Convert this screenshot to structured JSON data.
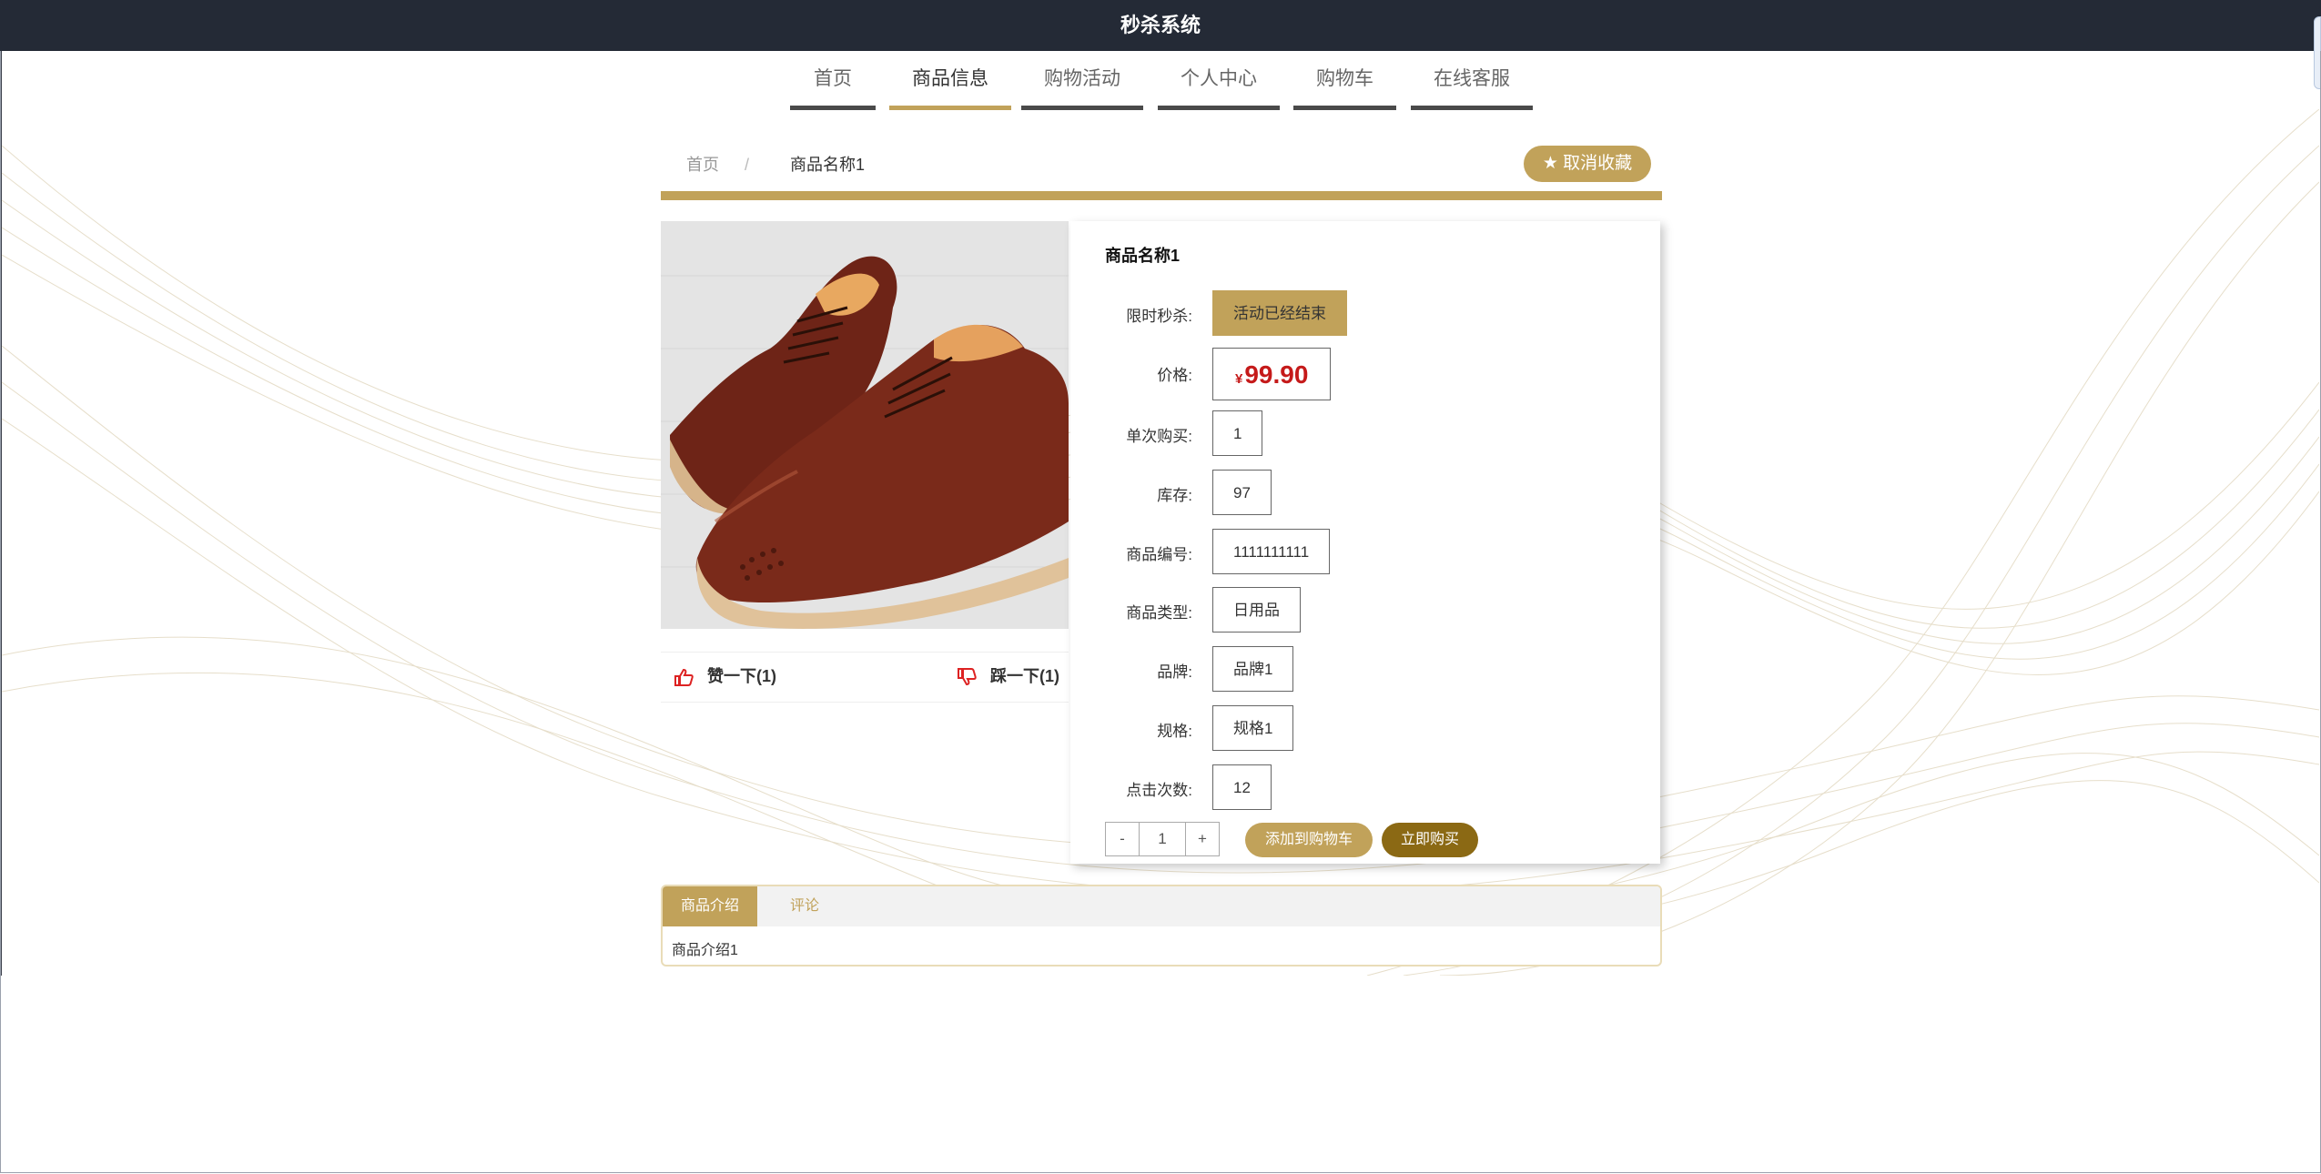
{
  "app": {
    "title": "秒杀系统"
  },
  "nav": {
    "items": [
      "首页",
      "商品信息",
      "购物活动",
      "个人中心",
      "购物车",
      "在线客服"
    ],
    "active": "商品信息"
  },
  "breadcrumb": {
    "home": "首页",
    "separator": "/",
    "current": "商品名称1"
  },
  "favorite": {
    "label": "取消收藏",
    "icon": "star-icon"
  },
  "product": {
    "name": "商品名称1",
    "image_alt": "brown leather brogue shoes",
    "likes": "赞一下(1)",
    "dislikes": "踩一下(1)",
    "fields": {
      "flash_sale": {
        "label": "限时秒杀:",
        "value": "活动已经结束"
      },
      "price": {
        "label": "价格:",
        "currency": "¥",
        "value": "99.90"
      },
      "single_purchase": {
        "label": "单次购买:",
        "value": "1"
      },
      "stock": {
        "label": "库存:",
        "value": "97"
      },
      "code": {
        "label": "商品编号:",
        "value": "1111111111"
      },
      "type": {
        "label": "商品类型:",
        "value": "日用品"
      },
      "brand": {
        "label": "品牌:",
        "value": "品牌1"
      },
      "spec": {
        "label": "规格:",
        "value": "规格1"
      },
      "clicks": {
        "label": "点击次数:",
        "value": "12"
      }
    },
    "quantity": {
      "minus": "-",
      "value": "1",
      "plus": "+"
    },
    "add_to_cart": "添加到购物车",
    "buy_now": "立即购买"
  },
  "tabs": {
    "items": [
      "商品介绍",
      "评论"
    ],
    "active": "商品介绍",
    "content": "商品介绍1"
  },
  "colors": {
    "accent": "#c1a25a",
    "topbar": "#242a36",
    "price": "#c51a1a",
    "buy": "#8b6914"
  }
}
